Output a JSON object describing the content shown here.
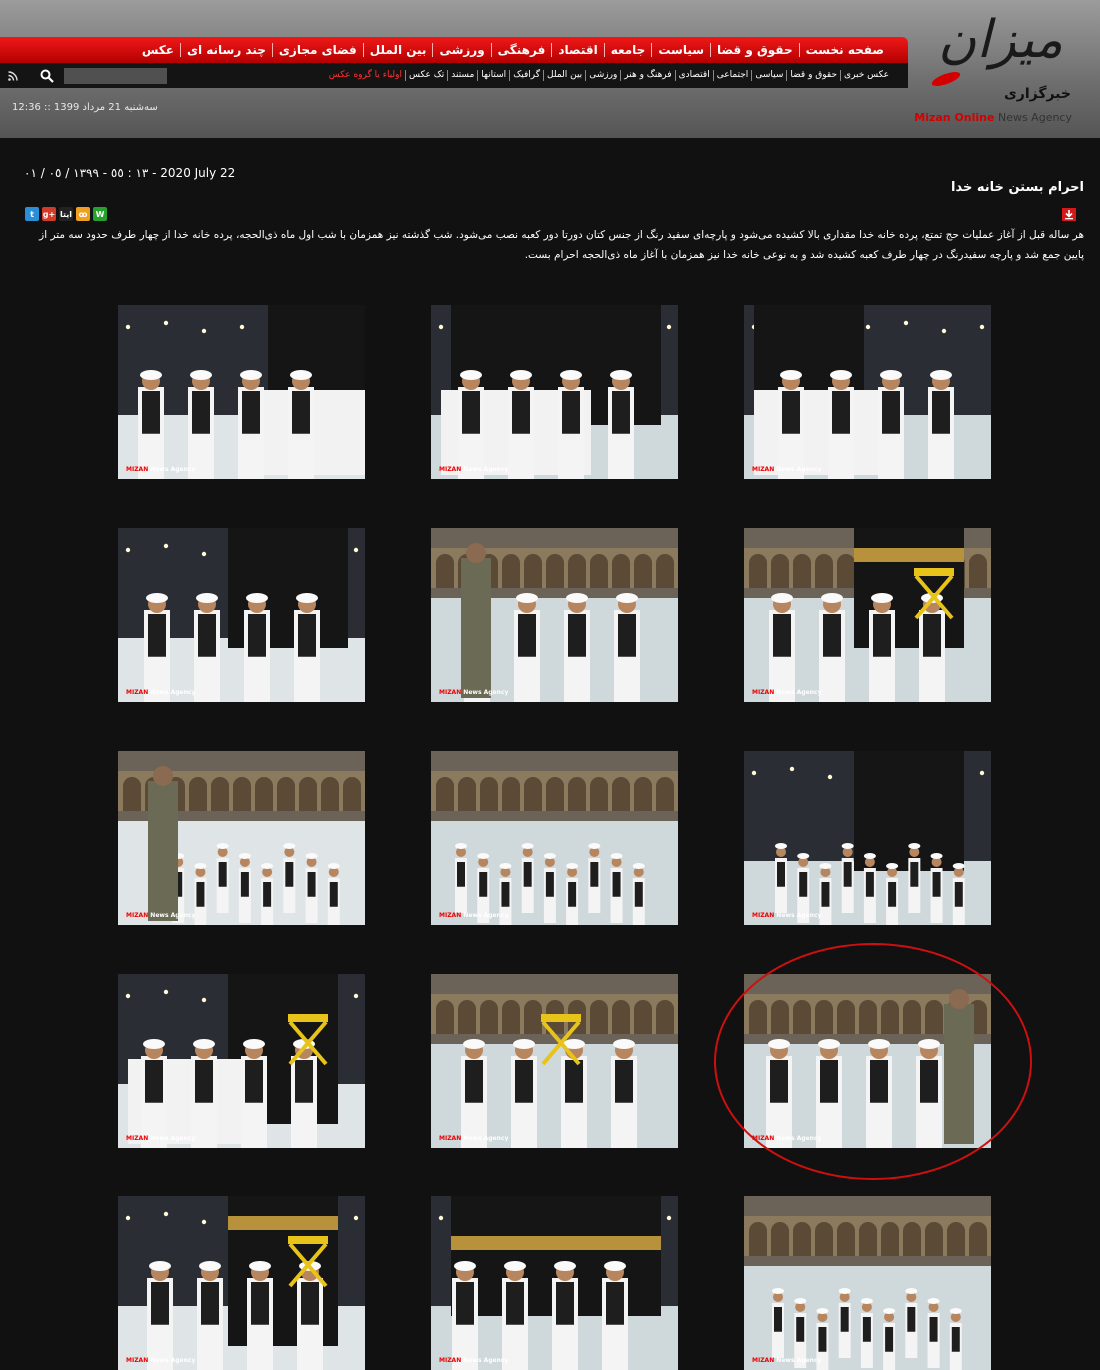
{
  "header": {
    "main_nav": [
      "صفحه نخست",
      "حقوق و قضا",
      "سیاست",
      "جامعه",
      "اقتصاد",
      "فرهنگی",
      "ورزشی",
      "بین الملل",
      "فضای مجازی",
      "چند رسانه ای",
      "عکس"
    ],
    "sub_nav": [
      "عکس خبری",
      "حقوق و قضا",
      "سیاسی",
      "اجتماعی",
      "اقتصادی",
      "فرهنگ و هنر",
      "ورزشی",
      "بین الملل",
      "گرافیک",
      "استانها",
      "مستند",
      "تک عکس"
    ],
    "sub_nav_highlight": "اولیاء یا گروه عکس",
    "search_placeholder": "",
    "datetime": "12:36 :: سه‌شنبه 21 مرداد 1399",
    "logo": {
      "mark": "میزان",
      "fa": "خبرگزاری",
      "en_bold": "Mizan Online",
      "en_rest": " News Agency"
    }
  },
  "article": {
    "date": "١٣ : ٥٥  -  ١٣٩٩ / ٠٥ / ٠١ - 2020 July 22",
    "title": "احرام بستن خانه خدا",
    "lead": "هر ساله قبل از آغاز عملیات حج تمتع، پرده خانه خدا مقداری بالا کشیده می‌شود و پارچه‌ای سفید رنگ از جنس کتان دورتا دور کعبه نصب می‌شود. شب گذشته نیز همزمان با شب اول ماه ذی‌الحجه، پرده خانه خدا از چهار طرف حدود سه متر از پایین جمع شد و پارچه سفیدرنگ در چهار طرف کعبه کشیده شد و به نوعی خانه خدا نیز همزمان با آغاز ماه ذی‌الحجه احرام بست."
  },
  "share": [
    {
      "icon": "whatsapp-icon",
      "label": "W",
      "color": "#25a22b"
    },
    {
      "icon": "soroush-icon",
      "label": "ꝏ",
      "color": "#f0a020"
    },
    {
      "icon": "eitaa-icon",
      "label": "ایتا",
      "color": "#222222"
    },
    {
      "icon": "googleplus-icon",
      "label": "g+",
      "color": "#d23a2a"
    },
    {
      "icon": "twitter-icon",
      "label": "t",
      "color": "#2a8fd8"
    }
  ],
  "watermark": {
    "bold": "MIZAN",
    "rest": " News Agency"
  },
  "gallery": [
    {
      "scene": "kaaba-cloth-workers-left"
    },
    {
      "scene": "kaaba-cloth-worker-center"
    },
    {
      "scene": "kaaba-cloth-workers-right"
    },
    {
      "scene": "kaaba-night-scaffold"
    },
    {
      "scene": "temperature-check"
    },
    {
      "scene": "kaaba-lifts-golden-door"
    },
    {
      "scene": "workers-security-left"
    },
    {
      "scene": "workers-courtyard"
    },
    {
      "scene": "workers-kaaba-base"
    },
    {
      "scene": "kaaba-scaffold-white-cloth"
    },
    {
      "scene": "workers-lift-courtyard"
    },
    {
      "scene": "worker-handshake-highlighted"
    },
    {
      "scene": "kaaba-gold-lift"
    },
    {
      "scene": "kaaba-night-overview"
    },
    {
      "scene": "workers-green-vests"
    }
  ]
}
